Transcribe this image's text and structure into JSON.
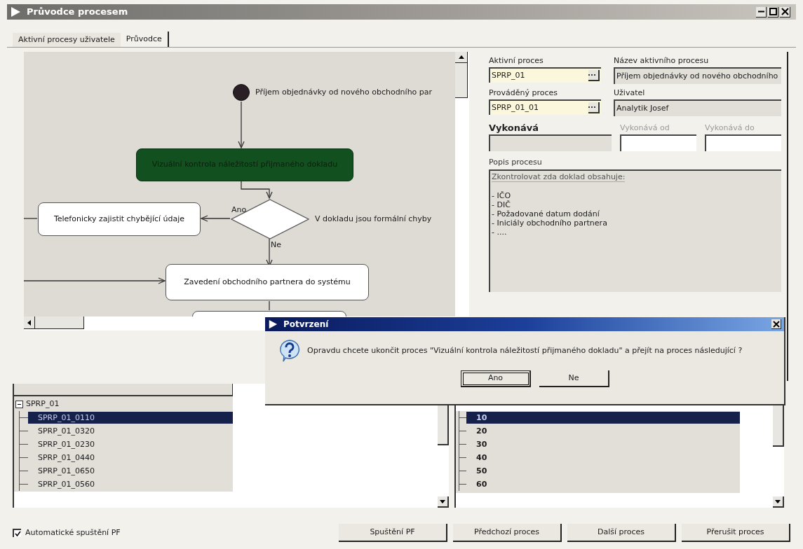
{
  "window": {
    "title": "Průvodce procesem"
  },
  "tabs": [
    {
      "label": "Aktivní procesy uživatele",
      "selected": false
    },
    {
      "label": "Průvodce",
      "selected": true
    }
  ],
  "diagram": {
    "nodes": [
      {
        "kind": "start",
        "label": "Příjem objednávky od nového obchodního par"
      },
      {
        "kind": "activity",
        "label": "Vizuální kontrola náležitostí přijmaného dokladu",
        "current": true
      },
      {
        "kind": "task",
        "label": "Telefonicky zajistit chybějící údaje",
        "current": false
      },
      {
        "kind": "decision",
        "label": "V dokladu jsou formální chyby"
      },
      {
        "kind": "task",
        "label": "Zavedení obchodního partnera do systému",
        "current": false
      }
    ],
    "branches": [
      {
        "label": "Ano"
      },
      {
        "label": "Ne"
      }
    ]
  },
  "fields": [
    {
      "label": "Aktivní proces",
      "value": "SPRP_01",
      "kind": "lookup",
      "label_bold": false,
      "label_dimmed": false
    },
    {
      "label": "Název aktivního procesu",
      "value": "Příjem objednávky od nového obchodního",
      "kind": "readonly",
      "label_bold": false,
      "label_dimmed": false
    },
    {
      "label": "Prováděný proces",
      "value": "SPRP_01_01",
      "kind": "lookup",
      "label_bold": false,
      "label_dimmed": false
    },
    {
      "label": "Uživatel",
      "value": "Analytik Josef",
      "kind": "readonly",
      "label_bold": false,
      "label_dimmed": false
    },
    {
      "label": "Vykonává",
      "kind": "readonly",
      "label_bold": true,
      "label_dimmed": false
    },
    {
      "label": "Vykonává od",
      "kind": "input",
      "label_bold": false,
      "label_dimmed": true
    },
    {
      "label": "Vykonává do",
      "kind": "input",
      "label_bold": false,
      "label_dimmed": true
    }
  ],
  "description": {
    "label": "Popis procesu",
    "lines": [
      "Zkontrolovat zda doklad obsahuje:",
      "- IČO",
      "- DIČ",
      "- Požadované datum dodání",
      "- Iniciály obchodního partnera",
      "- ...."
    ]
  },
  "tree": {
    "label": "SPRP_01",
    "expanded": true,
    "children": [
      {
        "label": "SPRP_01_0110",
        "selected": true
      },
      {
        "label": "SPRP_01_0320",
        "selected": false
      },
      {
        "label": "SPRP_01_0230",
        "selected": false
      },
      {
        "label": "SPRP_01_0440",
        "selected": false
      },
      {
        "label": "SPRP_01_0650",
        "selected": false
      },
      {
        "label": "SPRP_01_0560",
        "selected": false
      }
    ]
  },
  "steps": [
    {
      "label": "10",
      "selected": true
    },
    {
      "label": "20",
      "selected": false
    },
    {
      "label": "30",
      "selected": false
    },
    {
      "label": "40",
      "selected": false
    },
    {
      "label": "50",
      "selected": false
    },
    {
      "label": "60",
      "selected": false
    }
  ],
  "auto_start": {
    "label": "Automatické spuštění PF",
    "checked": true
  },
  "buttons": [
    "Spuštění PF",
    "Předchozí proces",
    "Další proces",
    "Přerušit proces"
  ],
  "dialog": {
    "title": "Potvrzení",
    "message": "Opravdu chcete ukončit proces \"Vizuální kontrola náležitostí přijmaného dokladu\" a přejít na proces následující ?",
    "buttons": [
      {
        "label": "Ano",
        "default": true
      },
      {
        "label": "Ne",
        "default": false
      }
    ]
  }
}
